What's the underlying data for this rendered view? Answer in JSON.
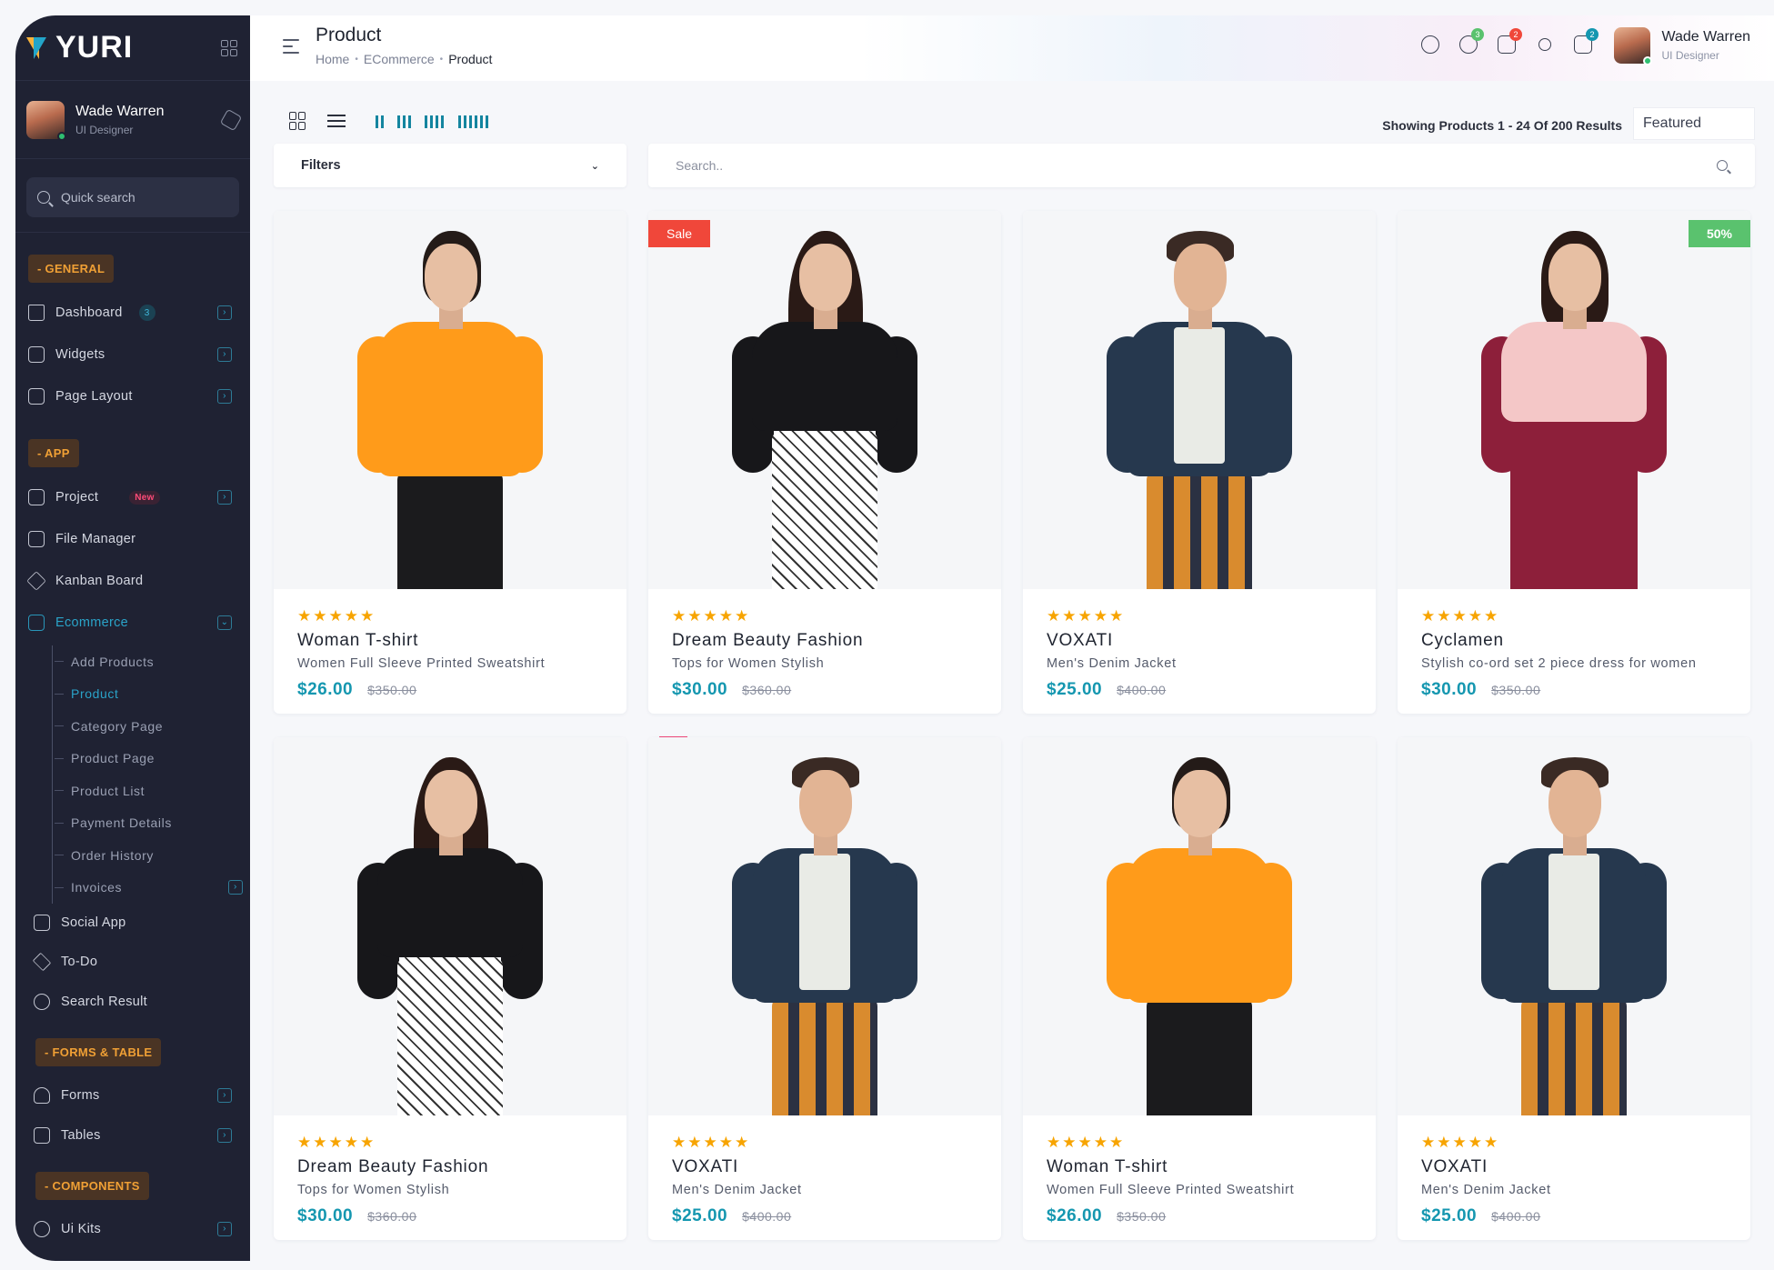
{
  "brand": {
    "name": "YURI"
  },
  "user": {
    "name": "Wade Warren",
    "role": "UI Designer"
  },
  "sidebar": {
    "quick_search": "Quick search",
    "sections": {
      "general": "- GENERAL",
      "app": "- APP",
      "forms": "- FORMS & TABLE",
      "components": "- COMPONENTS"
    },
    "general": [
      {
        "label": "Dashboard",
        "badge": "3"
      },
      {
        "label": "Widgets"
      },
      {
        "label": "Page Layout"
      }
    ],
    "app": [
      {
        "label": "Project",
        "badge": "New"
      },
      {
        "label": "File Manager"
      },
      {
        "label": "Kanban Board"
      },
      {
        "label": "Ecommerce"
      }
    ],
    "ecommerce_sub": [
      {
        "label": "Add Products"
      },
      {
        "label": "Product"
      },
      {
        "label": "Category Page"
      },
      {
        "label": "Product Page"
      },
      {
        "label": "Product List"
      },
      {
        "label": "Payment Details"
      },
      {
        "label": "Order History"
      },
      {
        "label": "Invoices"
      }
    ],
    "app_more": [
      {
        "label": "Social App"
      },
      {
        "label": "To-Do"
      },
      {
        "label": "Search Result"
      }
    ],
    "forms": [
      {
        "label": "Forms"
      },
      {
        "label": "Tables"
      }
    ],
    "components": [
      {
        "label": "Ui Kits"
      }
    ]
  },
  "header": {
    "title": "Product",
    "breadcrumb": [
      "Home",
      "ECommerce",
      "Product"
    ],
    "badges": {
      "notifications": "3",
      "cart": "2",
      "apps": "2"
    }
  },
  "toolbar": {
    "results": "Showing Products 1 - 24 Of 200 Results",
    "sort_value": "Featured",
    "filters_label": "Filters",
    "search_placeholder": "Search.."
  },
  "products": [
    {
      "name": "Woman T-shirt",
      "desc": "Women Full Sleeve Printed Sweatshirt",
      "price": "$26.00",
      "old_price": "$350.00",
      "stars": "★★★★★",
      "tag": ""
    },
    {
      "name": "Dream Beauty Fashion",
      "desc": "Tops for Women Stylish",
      "price": "$30.00",
      "old_price": "$360.00",
      "stars": "★★★★★",
      "tag": "Sale"
    },
    {
      "name": "VOXATI",
      "desc": "Men's Denim Jacket",
      "price": "$25.00",
      "old_price": "$400.00",
      "stars": "★★★★★",
      "tag": ""
    },
    {
      "name": "Cyclamen",
      "desc": "Stylish co-ord set 2 piece dress for women",
      "price": "$30.00",
      "old_price": "$350.00",
      "stars": "★★★★★",
      "tag": "50%"
    },
    {
      "name": "Dream Beauty Fashion",
      "desc": "Tops for Women Stylish",
      "price": "$30.00",
      "old_price": "$360.00",
      "stars": "★★★★★",
      "tag": ""
    },
    {
      "name": "VOXATI",
      "desc": "Men's Denim Jacket",
      "price": "$25.00",
      "old_price": "$400.00",
      "stars": "★★★★★",
      "tag": ""
    },
    {
      "name": "Woman T-shirt",
      "desc": "Women Full Sleeve Printed Sweatshirt",
      "price": "$26.00",
      "old_price": "$350.00",
      "stars": "★★★★★",
      "tag": ""
    },
    {
      "name": "VOXATI",
      "desc": "Men's Denim Jacket",
      "price": "$25.00",
      "old_price": "$400.00",
      "stars": "★★★★★",
      "tag": ""
    }
  ],
  "colors": {
    "accent": "#1597b0",
    "sidebar_bg": "#1f2233",
    "sale": "#f0473a",
    "discount": "#5ac26e",
    "stars": "#f7a400"
  }
}
